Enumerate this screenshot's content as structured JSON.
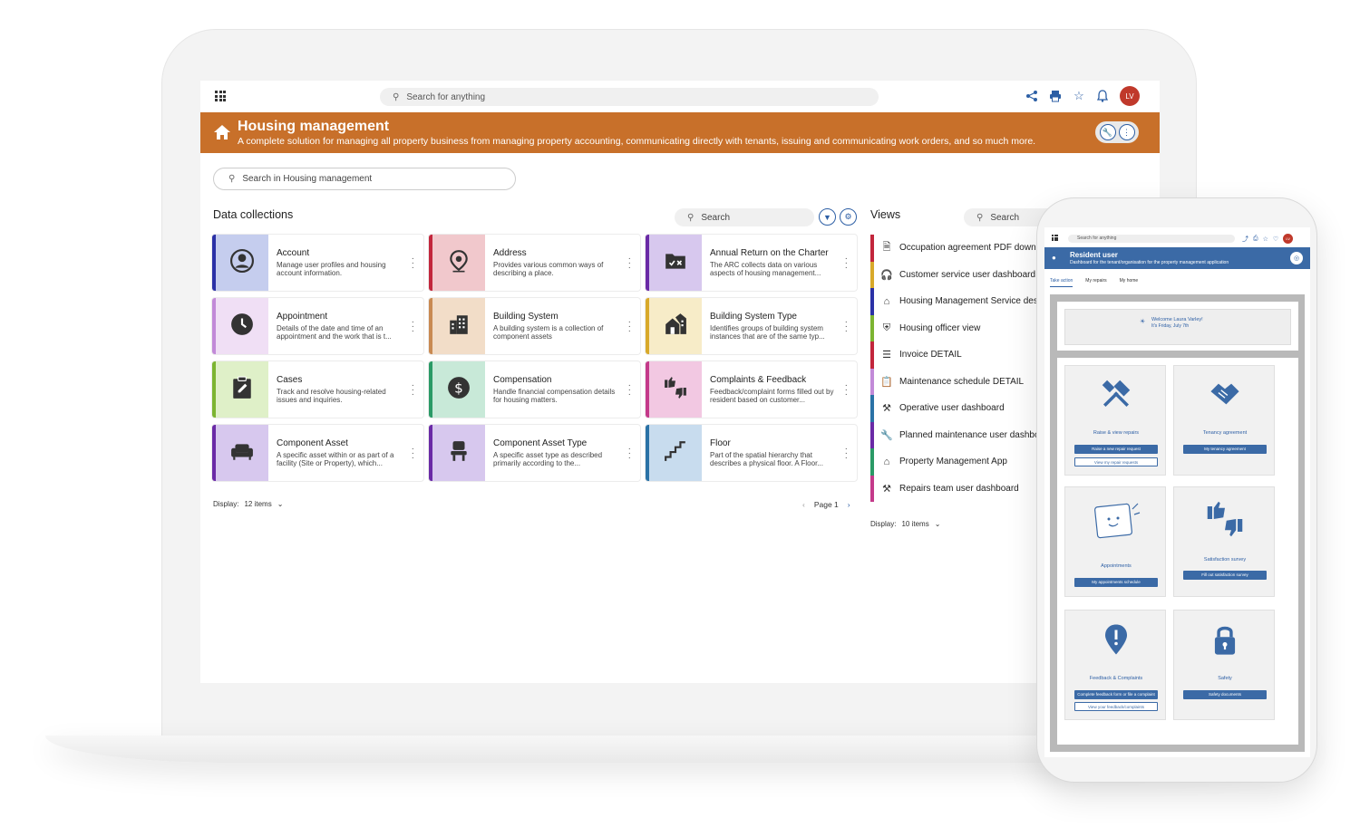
{
  "desktop": {
    "topbar": {
      "search_placeholder": "Search for anything",
      "avatar_initials": "LV"
    },
    "hero": {
      "title": "Housing management",
      "subtitle": "A complete solution for managing all property business from managing property accounting, communicating directly with tenants, issuing and communicating work orders, and so much more.",
      "background_color": "#c8702a"
    },
    "local_search_placeholder": "Search in Housing management",
    "data_collections": {
      "heading": "Data collections",
      "search_placeholder": "Search",
      "display_label": "Display:",
      "display_value": "12 items",
      "page_label": "Page 1",
      "cards": [
        {
          "title": "Account",
          "desc": "Manage user profiles and housing account information.",
          "icon": "account-circle-icon",
          "bar": "#2b31a6",
          "tile": "#c5cdee"
        },
        {
          "title": "Address",
          "desc": "Provides various common ways of describing a place.",
          "icon": "location-pin-icon",
          "bar": "#c2263c",
          "tile": "#f1c8cc"
        },
        {
          "title": "Annual Return on the Charter",
          "desc": "The ARC collects data on various aspects of housing management...",
          "icon": "folder-check-icon",
          "bar": "#6a2aa6",
          "tile": "#d7c8ee"
        },
        {
          "title": "Appointment",
          "desc": "Details of the date and time of an appointment and the work that is t...",
          "icon": "clock-icon",
          "bar": "#c28ad8",
          "tile": "#f0dff5"
        },
        {
          "title": "Building System",
          "desc": "A building system is a collection of component assets",
          "icon": "building-icon",
          "bar": "#c98a52",
          "tile": "#f2ddc8"
        },
        {
          "title": "Building System Type",
          "desc": "Identifies groups of building system instances that are of the same typ...",
          "icon": "house-group-icon",
          "bar": "#d8a92a",
          "tile": "#f7ecc8"
        },
        {
          "title": "Cases",
          "desc": "Track and resolve housing-related issues and inquiries.",
          "icon": "clipboard-edit-icon",
          "bar": "#7cb431",
          "tile": "#dff0c8"
        },
        {
          "title": "Compensation",
          "desc": "Handle financial compensation details for housing matters.",
          "icon": "dollar-icon",
          "bar": "#2a9a66",
          "tile": "#c8e9d8"
        },
        {
          "title": "Complaints & Feedback",
          "desc": "Feedback/complaint forms filled out by resident based on customer...",
          "icon": "thumbs-up-down-icon",
          "bar": "#c43a8a",
          "tile": "#f2c8e2"
        },
        {
          "title": "Component Asset",
          "desc": "A specific asset within or as part of a facility (Site or Property), which...",
          "icon": "sofa-icon",
          "bar": "#6a2aa6",
          "tile": "#d7c8ee"
        },
        {
          "title": "Component Asset Type",
          "desc": "A specific asset type as described primarily according to the...",
          "icon": "chair-icon",
          "bar": "#6a2aa6",
          "tile": "#d7c8ee"
        },
        {
          "title": "Floor",
          "desc": "Part of the spatial hierarchy that describes a physical floor. A Floor...",
          "icon": "stairs-icon",
          "bar": "#2a72a6",
          "tile": "#c8dcee"
        }
      ]
    },
    "views": {
      "heading": "Views",
      "search_placeholder": "Search",
      "display_label": "Display:",
      "display_value": "10 items",
      "items": [
        {
          "label": "Occupation agreement PDF downlo",
          "icon": "document-icon",
          "bar": "#c2263c"
        },
        {
          "label": "Customer service user dashboard",
          "icon": "headset-icon",
          "bar": "#d8a92a"
        },
        {
          "label": "Housing Management Service desk",
          "icon": "home-icon",
          "bar": "#2b31a6"
        },
        {
          "label": "Housing officer view",
          "icon": "shield-icon",
          "bar": "#7cb431"
        },
        {
          "label": "Invoice DETAIL",
          "icon": "list-icon",
          "bar": "#c2263c"
        },
        {
          "label": "Maintenance schedule DETAIL",
          "icon": "clipboard-icon",
          "bar": "#c28ad8"
        },
        {
          "label": "Operative user dashboard",
          "icon": "tools-icon",
          "bar": "#2a72a6"
        },
        {
          "label": "Planned maintenance user dashbo",
          "icon": "wrench-icon",
          "bar": "#6a2aa6"
        },
        {
          "label": "Property Management App",
          "icon": "home-icon",
          "bar": "#2a9a66"
        },
        {
          "label": "Repairs team user dashboard",
          "icon": "tools-icon",
          "bar": "#c43a8a"
        }
      ]
    }
  },
  "phone": {
    "search_placeholder": "Search for anything",
    "avatar_initials": "LV",
    "hero_title": "Resident user",
    "hero_subtitle": "Dashboard for the tenant/organisation for the property management application",
    "tabs": [
      "Take action",
      "My repairs",
      "My home"
    ],
    "welcome_line1": "Welcome Laura Varley!",
    "welcome_line2": "It's Friday, July 7th",
    "tiles": [
      {
        "title": "Raise & view repairs",
        "buttons": [
          "Raise a new repair request",
          "View my repair requests"
        ],
        "icon": "tools-icon"
      },
      {
        "title": "Tenancy agreement",
        "buttons": [
          "My tenancy agreement"
        ],
        "icon": "handshake-icon"
      },
      {
        "title": "Appointments",
        "buttons": [
          "My appointments schedule"
        ],
        "icon": "calendar-illustration-icon"
      },
      {
        "title": "Satisfaction survey",
        "buttons": [
          "Fill out satisfaction survey"
        ],
        "icon": "thumbs-up-down-icon"
      },
      {
        "title": "Feedback & Complaints",
        "buttons": [
          "Complete feedback form or file a complaint",
          "View your feedback/complaints"
        ],
        "icon": "alert-pin-icon"
      },
      {
        "title": "Safety",
        "buttons": [
          "Safety documents"
        ],
        "icon": "lock-icon"
      }
    ]
  }
}
